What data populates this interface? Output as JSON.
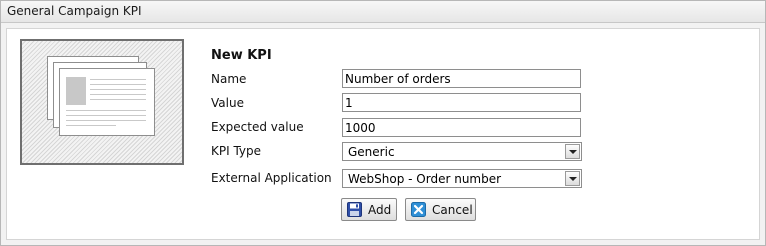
{
  "panel": {
    "title": "General Campaign KPI"
  },
  "form": {
    "heading": "New KPI",
    "fields": {
      "name": {
        "label": "Name",
        "value": "Number of orders"
      },
      "value": {
        "label": "Value",
        "value": "1"
      },
      "expected": {
        "label": "Expected value",
        "value": "1000"
      },
      "kpi_type": {
        "label": "KPI Type",
        "selected": "Generic"
      },
      "external_app": {
        "label": "External Application",
        "selected": "WebShop - Order number"
      }
    },
    "buttons": {
      "add": "Add",
      "cancel": "Cancel"
    }
  },
  "icons": {
    "thumbnail": "document-placeholder-icon",
    "add": "floppy-disk-icon",
    "cancel": "close-x-icon"
  },
  "colors": {
    "add_icon": "#2f4fa8",
    "cancel_icon": "#2f8fd6"
  }
}
